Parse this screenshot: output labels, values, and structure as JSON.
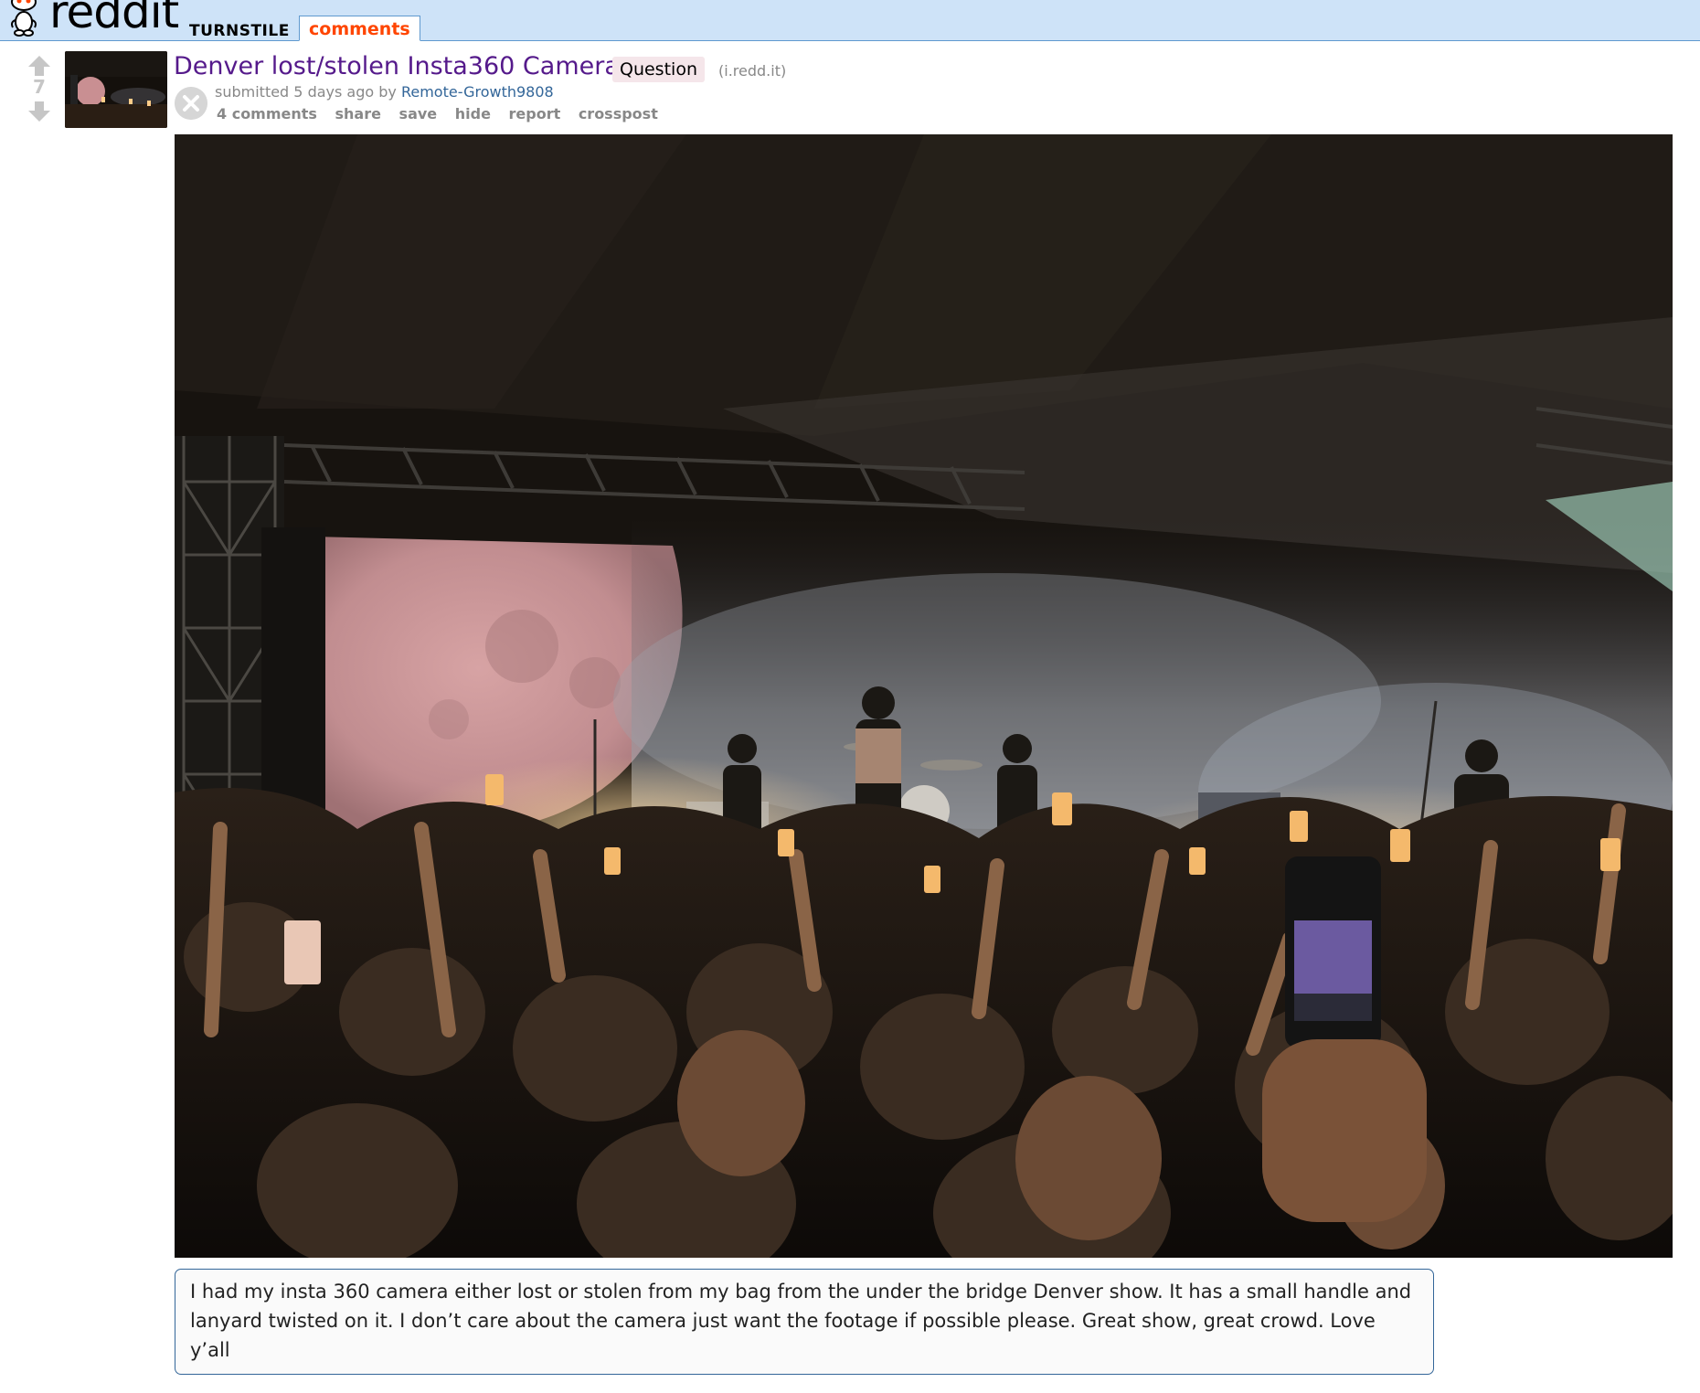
{
  "header": {
    "wordmark": "reddit",
    "subreddit": "TURNSTILE",
    "active_tab": "comments",
    "accent_color": "#ff4500",
    "background_color": "#cee3f8"
  },
  "post": {
    "score": "7",
    "title": "Denver lost/stolen Insta360 Camera",
    "flair": "Question",
    "domain": "(i.redd.it)",
    "submitted_prefix": "submitted 5 days ago by",
    "author": "Remote-Growth9808",
    "title_color": "#551a8b",
    "buttons": {
      "comments": "4 comments",
      "share": "share",
      "save": "save",
      "hide": "hide",
      "report": "report",
      "crosspost": "crosspost"
    },
    "image_description_icon": "concert-photo",
    "selftext": "I had my insta 360 camera either lost or stolen from my bag from the under the bridge Denver show. It has a small handle and lanyard twisted on it. I don’t care about the camera just want the footage if possible please. Great show, great crowd. Love y’all"
  },
  "icons": {
    "logo": "reddit-alien-icon",
    "upvote": "upvote-arrow-icon",
    "downvote": "downvote-arrow-icon",
    "close": "close-icon"
  }
}
